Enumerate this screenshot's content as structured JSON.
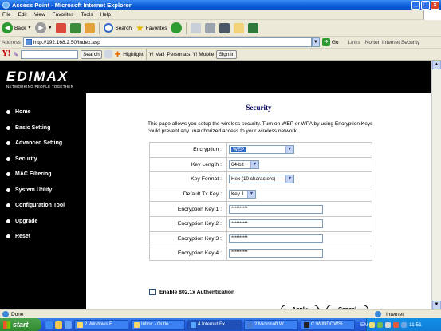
{
  "window": {
    "title": "Access Point - Microsoft Internet Explorer"
  },
  "menu": [
    "File",
    "Edit",
    "View",
    "Favorites",
    "Tools",
    "Help"
  ],
  "toolbar": {
    "back": "Back",
    "search": "Search",
    "favorites": "Favorites"
  },
  "address": {
    "label": "Address",
    "url": "http://192.168.2.50/index.asp",
    "go": "Go",
    "links": "Links",
    "norton": "Norton Internet Security"
  },
  "yahoo": {
    "logo": "Y!",
    "search": "Search",
    "highlight": "Highlight",
    "mail": "Y! Mail",
    "personals": "Personals",
    "mobile": "Y! Mobile",
    "signin": "Sign in"
  },
  "brand": {
    "name": "EDIMAX",
    "tagline": "NETWORKING PEOPLE TOGETHER"
  },
  "nav": [
    "Home",
    "Basic Setting",
    "Advanced Setting",
    "Security",
    "MAC Filtering",
    "System Utility",
    "Configuration Tool",
    "Upgrade",
    "Reset"
  ],
  "security": {
    "title": "Security",
    "description": "This page allows you setup the wireless security. Turn on WEP or WPA by using Encryption Keys could prevent any unauthorized access to your wireless network.",
    "fields": [
      {
        "label": "Encryption :",
        "type": "select",
        "value": "WEP"
      },
      {
        "label": "Key Length :",
        "type": "select",
        "value": "64-bit"
      },
      {
        "label": "Key Format :",
        "type": "select",
        "value": "Hex (10 characters)"
      },
      {
        "label": "Default Tx Key :",
        "type": "select",
        "value": "Key 1"
      },
      {
        "label": "Encryption Key 1 :",
        "type": "password",
        "value": "**********"
      },
      {
        "label": "Encryption Key 2 :",
        "type": "password",
        "value": "**********"
      },
      {
        "label": "Encryption Key 3 :",
        "type": "password",
        "value": "**********"
      },
      {
        "label": "Encryption Key 4 :",
        "type": "password",
        "value": "**********"
      }
    ],
    "checkbox_label": "Enable 802.1x Authentication",
    "apply": "Apply",
    "cancel": "Cancel"
  },
  "status": {
    "text": "Done",
    "zone": "Internet"
  },
  "taskbar": {
    "start": "start",
    "tasks": [
      "2 Windows E...",
      "Inbox - Outlo...",
      "4 Internet Ex...",
      "2 Microsoft W...",
      "C:\\WINDOWS\\..."
    ],
    "lang": "EN",
    "clock": "11:51"
  },
  "colors": {
    "accent": "#316ac5",
    "title_color": "#000066",
    "nav_bg": "#000000"
  }
}
